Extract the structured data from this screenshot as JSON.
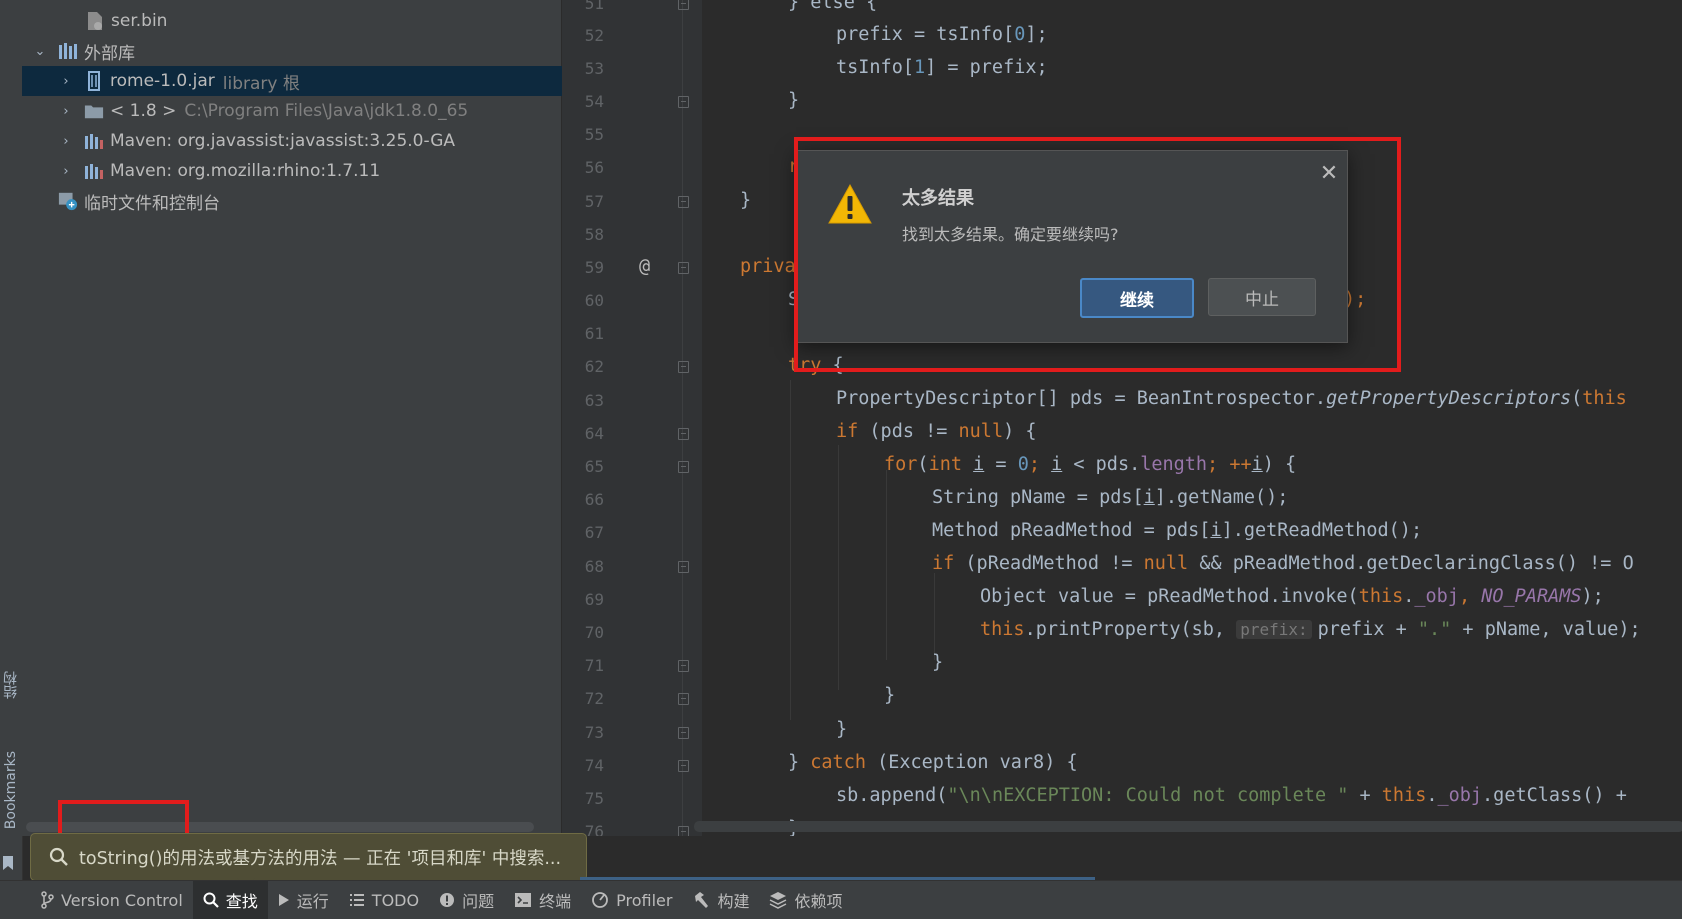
{
  "sidebar_strip": {
    "structure_label": "结构",
    "bookmarks_label": "Bookmarks"
  },
  "project_tree": {
    "items": [
      {
        "label": "ser.bin",
        "icon": "binary-file-icon"
      },
      {
        "label": "外部库",
        "icon": "library-icon"
      },
      {
        "label": "rome-1.0.jar",
        "suffix": "library 根",
        "icon": "jar-icon"
      },
      {
        "label": "< 1.8 >",
        "suffix": "C:\\Program Files\\Java\\jdk1.8.0_65",
        "icon": "jdk-folder-icon"
      },
      {
        "label": "Maven: org.javassist:javassist:3.25.0-GA",
        "icon": "maven-library-icon"
      },
      {
        "label": "Maven: org.mozilla:rhino:1.7.11",
        "icon": "maven-library-icon"
      },
      {
        "label": "临时文件和控制台",
        "icon": "scratch-console-icon"
      }
    ]
  },
  "editor": {
    "line_numbers": [
      "51",
      "52",
      "53",
      "54",
      "55",
      "56",
      "57",
      "58",
      "59",
      "60",
      "61",
      "62",
      "63",
      "64",
      "65",
      "66",
      "67",
      "68",
      "69",
      "70",
      "71",
      "72",
      "73",
      "74",
      "75",
      "76"
    ],
    "code_lines": {
      "l51": "} else {",
      "l52a": "prefix = tsInfo[",
      "l52b": "0",
      "l52c": "];",
      "l53a": "tsInfo[",
      "l53b": "1",
      "l53c": "] = prefix;",
      "l54": "}",
      "l56": "r",
      "l57": "}",
      "l59a": "@",
      "l59b": "priva",
      "l60a": "S",
      "l60b": ");",
      "l62a": "try",
      "l62b": " {",
      "l63a": "PropertyDescriptor[] pds = BeanIntrospector.",
      "l63b": "getPropertyDescriptors",
      "l63c": "(",
      "l63d": "this",
      "l64a": "if",
      "l64b": " (pds != ",
      "l64c": "null",
      "l64d": ") {",
      "l65a": "for",
      "l65b": "(",
      "l65c": "int",
      "l65d": " ",
      "l65e": "i",
      "l65f": " = ",
      "l65g": "0",
      "l65h": "; ",
      "l65i": "i",
      "l65j": " < pds.",
      "l65k": "length",
      "l65l": "; ++",
      "l65m": "i",
      "l65n": ") {",
      "l66a": "String pName = pds[",
      "l66b": "i",
      "l66c": "].getName();",
      "l67a": "Method pReadMethod = pds[",
      "l67b": "i",
      "l67c": "].getReadMethod();",
      "l68a": "if",
      "l68b": " (pReadMethod != ",
      "l68c": "null",
      "l68d": " && pReadMethod.getDeclaringClass() != O",
      "l69a": "Object value = pReadMethod.invoke(",
      "l69b": "this",
      "l69c": ".",
      "l69d": "_obj",
      "l69e": ", ",
      "l69f": "NO_PARAMS",
      "l69g": ");",
      "l70a": "this",
      "l70b": ".printProperty(sb, ",
      "l70hint": "prefix:",
      "l70c": "prefix + ",
      "l70d": "\".\"",
      "l70e": " + pName, value);",
      "l71": "}",
      "l72": "}",
      "l73": "}",
      "l74a": "} ",
      "l74b": "catch",
      "l74c": " (Exception var8) {",
      "l75a": "sb.append(",
      "l75b": "\"\\n\\nEXCEPTION: Could not complete \"",
      "l75c": " + ",
      "l75d": "this",
      "l75e": ".",
      "l75f": "_obj",
      "l75g": ".getClass() +",
      "l76": "}"
    }
  },
  "dialog": {
    "title": "太多结果",
    "message": "找到太多结果。确定要继续吗?",
    "continue_label": "继续",
    "abort_label": "中止",
    "close_symbol": "✕",
    "icon": "warning-icon"
  },
  "toast": {
    "text": "toString()的用法或基方法的用法 — 正在 '项目和库' 中搜索...",
    "icon": "search-icon"
  },
  "bottom_tabs": [
    {
      "label": "Version Control",
      "icon": "branch-icon"
    },
    {
      "label": "查找",
      "icon": "search-icon",
      "active": true
    },
    {
      "label": "运行",
      "icon": "run-icon"
    },
    {
      "label": "TODO",
      "icon": "list-icon"
    },
    {
      "label": "问题",
      "icon": "problems-icon"
    },
    {
      "label": "终端",
      "icon": "terminal-icon"
    },
    {
      "label": "Profiler",
      "icon": "profiler-icon"
    },
    {
      "label": "构建",
      "icon": "hammer-icon"
    },
    {
      "label": "依赖项",
      "icon": "layers-icon"
    }
  ],
  "colors": {
    "highlight_red": "#e21c1c",
    "selection_blue": "#0d293e",
    "primary_button": "#365880",
    "keyword_orange": "#cc7832"
  }
}
